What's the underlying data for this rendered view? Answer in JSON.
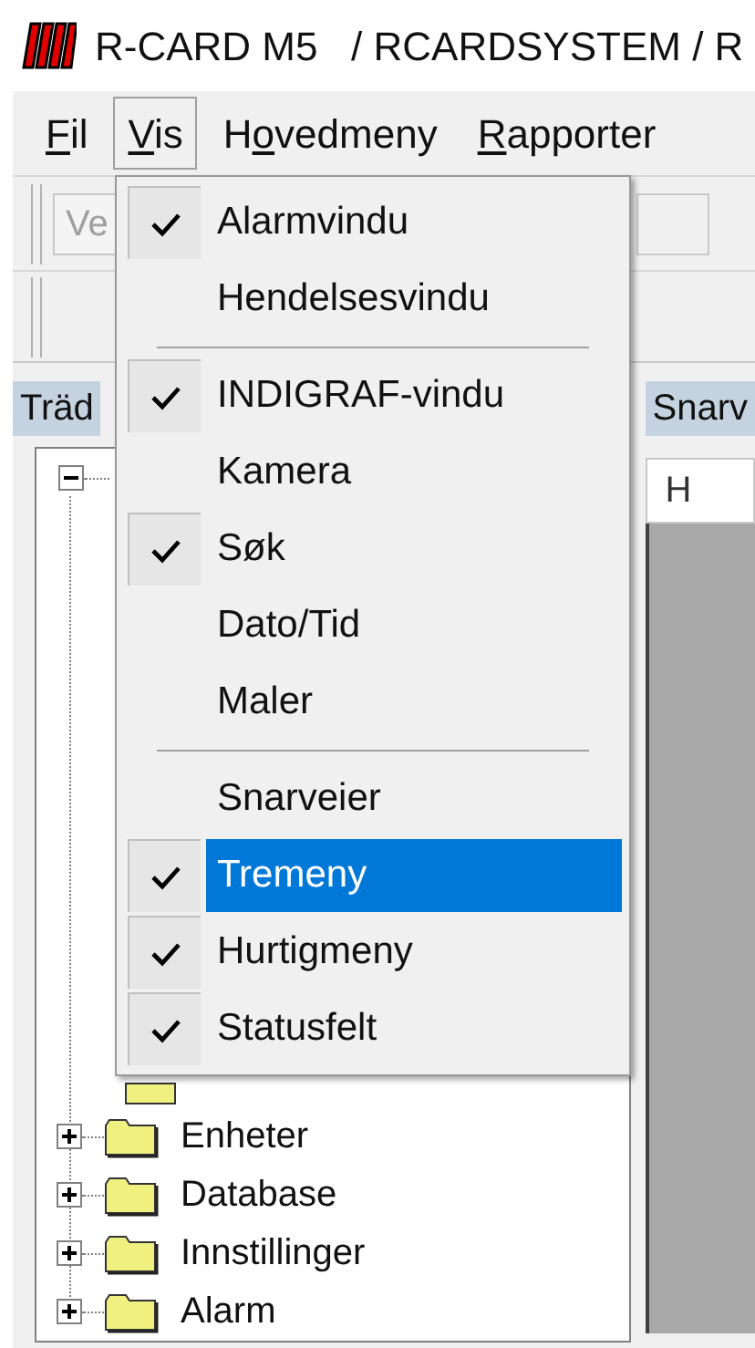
{
  "window": {
    "title": "R-CARD M5   / RCARDSYSTEM / R"
  },
  "menubar": [
    {
      "key": "F",
      "post": "il",
      "selected": false
    },
    {
      "key": "V",
      "post": "is",
      "selected": true
    },
    {
      "pre": "H",
      "key": "o",
      "post": "vedmeny",
      "selected": false
    },
    {
      "key": "R",
      "post": "apporter",
      "selected": false
    }
  ],
  "toolbar": {
    "combo_value": "Ve"
  },
  "tree_panel": {
    "title": "Träd",
    "root": {
      "expanded": true,
      "children": [
        {
          "label": "Enheter",
          "expanded": false
        },
        {
          "label": "Database",
          "expanded": false
        },
        {
          "label": "Innstillinger",
          "expanded": false
        },
        {
          "label": "Alarm",
          "expanded": false
        }
      ]
    }
  },
  "shortcut_panel": {
    "title": "Snarv",
    "tab": "H"
  },
  "menu": [
    {
      "kind": "item",
      "label": "Alarmvindu",
      "checked": true,
      "selected": false
    },
    {
      "kind": "item",
      "label": "Hendelsesvindu",
      "checked": false,
      "selected": false
    },
    {
      "kind": "separator"
    },
    {
      "kind": "item",
      "label": "INDIGRAF-vindu",
      "checked": true,
      "selected": false
    },
    {
      "kind": "item",
      "label": "Kamera",
      "checked": false,
      "selected": false
    },
    {
      "kind": "item",
      "label": "Søk",
      "checked": true,
      "selected": false
    },
    {
      "kind": "item",
      "label": "Dato/Tid",
      "checked": false,
      "selected": false
    },
    {
      "kind": "item",
      "label": "Maler",
      "checked": false,
      "selected": false
    },
    {
      "kind": "separator"
    },
    {
      "kind": "item",
      "label": "Snarveier",
      "checked": false,
      "selected": false
    },
    {
      "kind": "item",
      "label": "Tremeny",
      "checked": true,
      "selected": true
    },
    {
      "kind": "item",
      "label": "Hurtigmeny",
      "checked": true,
      "selected": false
    },
    {
      "kind": "item",
      "label": "Statusfelt",
      "checked": true,
      "selected": false
    }
  ]
}
